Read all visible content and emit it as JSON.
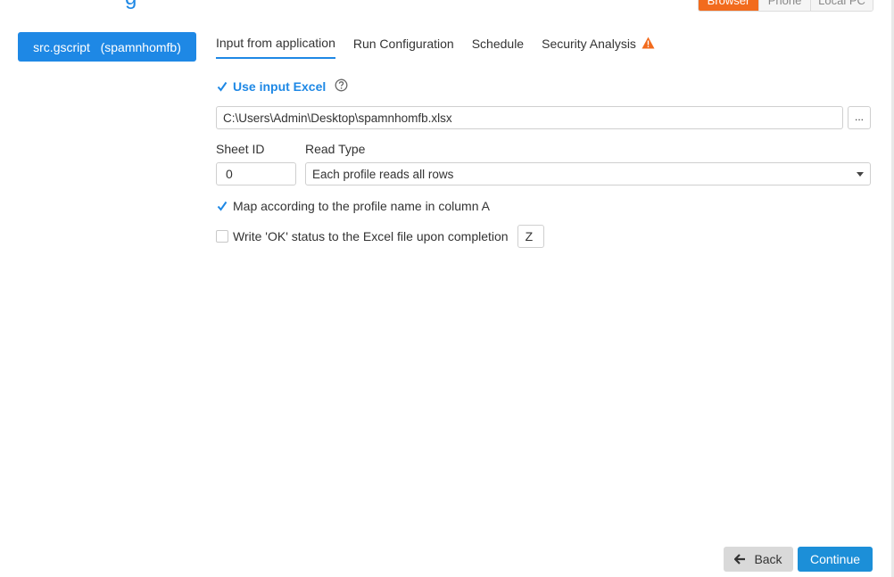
{
  "header": {
    "title": "g",
    "modes": [
      "Browser",
      "Phone",
      "Local PC"
    ],
    "active_mode": "Browser"
  },
  "sidebar": {
    "items": [
      {
        "label": "src.gscript   (spamnhomfb)"
      }
    ]
  },
  "tabs": [
    {
      "label": "Input from application",
      "active": true
    },
    {
      "label": "Run Configuration"
    },
    {
      "label": "Schedule"
    },
    {
      "label": "Security Analysis",
      "icon": "warning-icon"
    }
  ],
  "form": {
    "use_input_excel": {
      "label": "Use input Excel",
      "checked": true,
      "help_icon": "help-circle-icon"
    },
    "file_path": {
      "value": "C:\\Users\\Admin\\Desktop\\spamnhomfb.xlsx"
    },
    "browse_label": "...",
    "sheet_id": {
      "label": "Sheet ID",
      "value": "0"
    },
    "read_type": {
      "label": "Read Type",
      "value": "Each profile reads all rows"
    },
    "map_by_profile": {
      "label": "Map according to the profile name in column A",
      "checked": true
    },
    "write_ok": {
      "label": "Write 'OK' status to the Excel file upon completion",
      "checked": false,
      "column": "Z"
    }
  },
  "footer": {
    "back_label": "Back",
    "continue_label": "Continue"
  },
  "colors": {
    "accent": "#1e88e5",
    "mode_active": "#f26b1d",
    "warning": "#f26b1d"
  }
}
